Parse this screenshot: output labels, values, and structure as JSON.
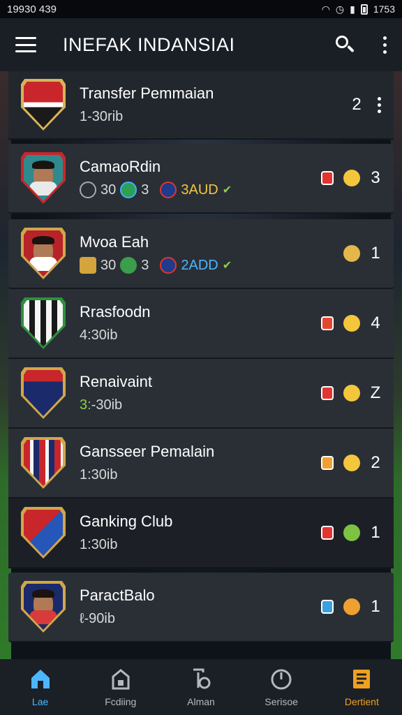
{
  "status_bar": {
    "time_left": "19930 439",
    "clock": "1753"
  },
  "app_bar": {
    "title": "INEFAK INDANSIAI"
  },
  "rows": [
    {
      "name": "Transfer Pemmaian",
      "sub": "1-30rib",
      "count": "2",
      "crest": "club-red-white",
      "tag_color": "",
      "medal_color": ""
    },
    {
      "name": "CamaoRdin",
      "stat_a": "30",
      "stat_b": "3",
      "extra": "3AUD",
      "count": "3",
      "crest": "player",
      "tag_color": "#e3342f",
      "medal_color": "#f3c63c"
    },
    {
      "name": "Mvoa Eah",
      "stat_a": "30",
      "stat_b": "3",
      "extra": "2ADD",
      "count": "1",
      "crest": "player-red",
      "tag_color": "",
      "medal_color": "#e5b74a"
    },
    {
      "name": "Rrasfoodn",
      "sub": "4:30ib",
      "count": "4",
      "crest": "club-black-white",
      "tag_color": "#e3472f",
      "medal_color": "#f3c63c"
    },
    {
      "name": "Renaivaint",
      "sub_accent": "3:",
      "sub": "-30ib",
      "count": "Z",
      "crest": "club-navy-orange",
      "tag_color": "#e3342f",
      "medal_color": "#f3c63c"
    },
    {
      "name": "Gansseer Pemalain",
      "sub": "1:30ib",
      "count": "2",
      "crest": "club-red-navy",
      "tag_color": "#f0a030",
      "medal_color": "#f3c63c"
    },
    {
      "name": "Ganking Club",
      "sub": "1:30ib",
      "count": "1",
      "crest": "club-blue-red",
      "tag_color": "#e3342f",
      "medal_color": "#7cc243"
    },
    {
      "name": "ParactBalo",
      "sub": "ℓ-90ib",
      "count": "1",
      "crest": "player-navy",
      "tag_color": "#3aa0e0",
      "medal_color": "#f0a030"
    }
  ],
  "nav": [
    {
      "label": "Lae",
      "icon": "home-icon"
    },
    {
      "label": "Fcdiing",
      "icon": "shop-icon"
    },
    {
      "label": "Alman",
      "icon": "lamp-icon"
    },
    {
      "label": "Serisoe",
      "icon": "clock-icon"
    },
    {
      "label": "Dertient",
      "icon": "document-icon"
    }
  ],
  "colors": {
    "accent": "#4cb7ff",
    "gold": "#f0a020"
  }
}
